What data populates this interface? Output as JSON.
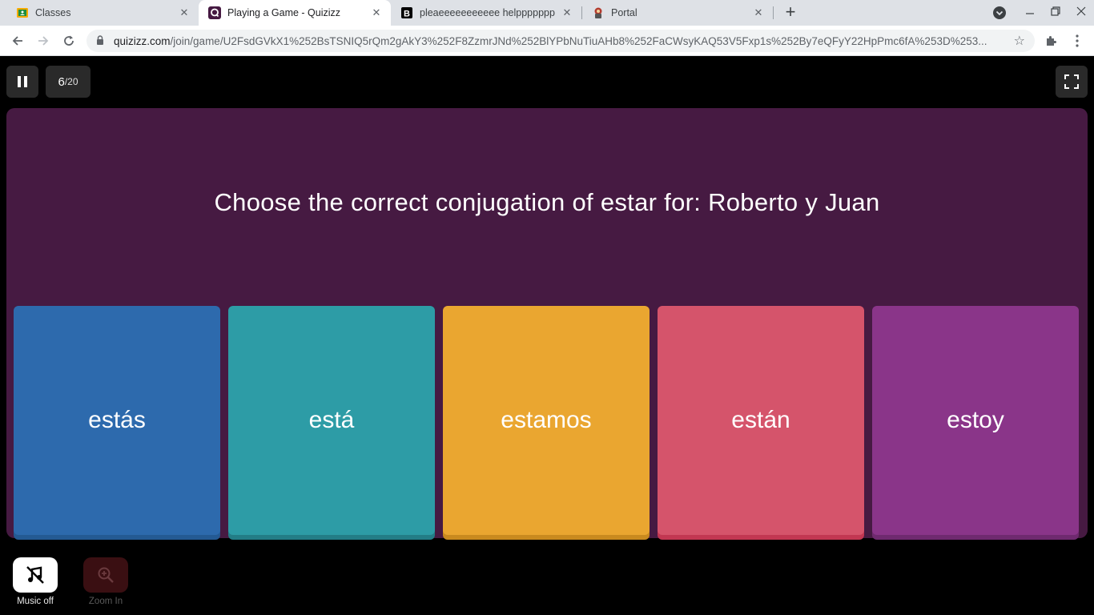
{
  "browser": {
    "tabs": [
      {
        "title": "Classes",
        "favicon": "google-classroom-icon",
        "active": false
      },
      {
        "title": "Playing a Game - Quizizz",
        "favicon": "quizizz-icon",
        "active": true
      },
      {
        "title": "pleaeeeeeeeeeee helppppppp - B",
        "favicon": "brainly-icon",
        "active": false
      },
      {
        "title": "Portal",
        "favicon": "portal-icon",
        "active": false
      }
    ],
    "new_tab": "+",
    "url_host": "quizizz.com",
    "url_path": "/join/game/U2FsdGVkX1%252BsTSNIQ5rQm2gAkY3%252F8ZzmrJNd%252BlYPbNuTiuAHb8%252FaCWsyKAQ53V5Fxp1s%252By7eQFyY22HpPmc6fA%253D%253..."
  },
  "game": {
    "current": "6",
    "total": "/20",
    "question": "Choose the correct conjugation of estar for: Roberto y Juan",
    "options": [
      {
        "label": "estás",
        "color": "#2d6aad",
        "shadow": "#245a93"
      },
      {
        "label": "está",
        "color": "#2d9ca6",
        "shadow": "#237d86"
      },
      {
        "label": "estamos",
        "color": "#eaa630",
        "shadow": "#c98a1f"
      },
      {
        "label": "están",
        "color": "#d5546b",
        "shadow": "#c23752"
      },
      {
        "label": "estoy",
        "color": "#8a3589",
        "shadow": "#6f2a6f"
      }
    ],
    "music_label": "Music off",
    "zoom_label": "Zoom In"
  },
  "colors": {
    "card_bg": "#461a42",
    "page_bg": "#000000"
  }
}
